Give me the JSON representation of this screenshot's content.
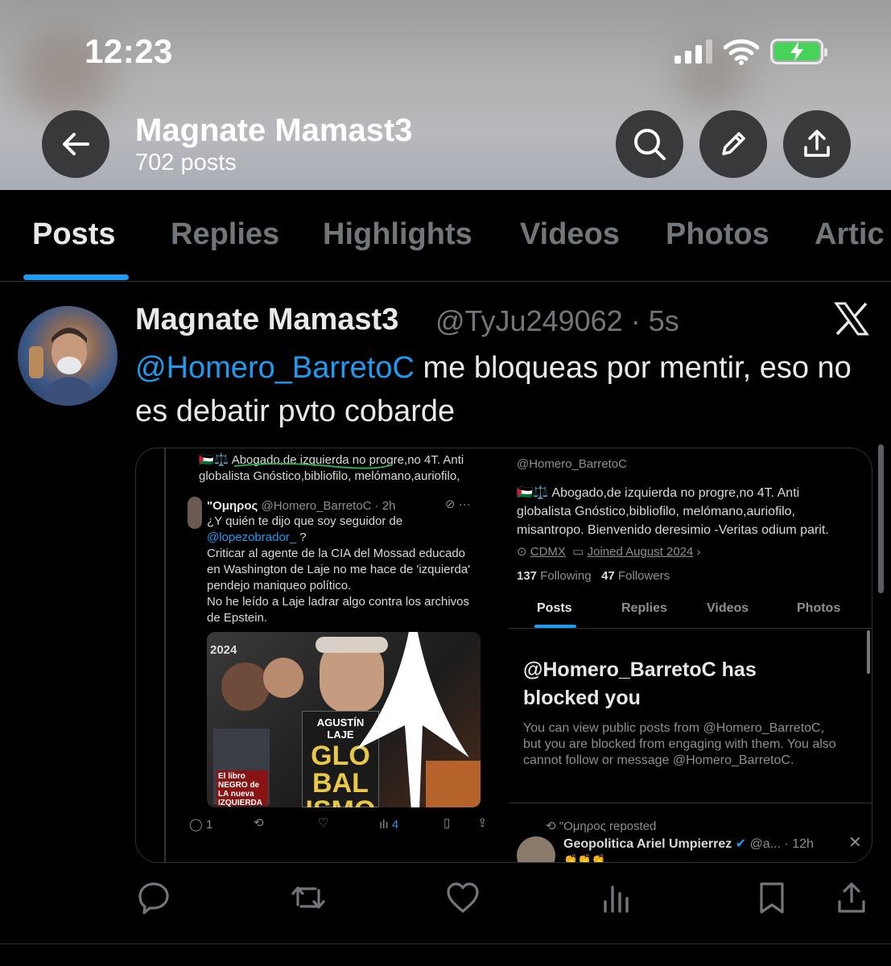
{
  "status_bar": {
    "time": "12:23"
  },
  "header": {
    "profile_name": "Magnate Mamast3",
    "post_count": "702 posts",
    "icons": [
      "back-arrow-icon",
      "search-icon",
      "pencil-icon",
      "share-icon"
    ]
  },
  "tabs": [
    {
      "label": "Posts",
      "active": true
    },
    {
      "label": "Replies",
      "active": false
    },
    {
      "label": "Highlights",
      "active": false
    },
    {
      "label": "Videos",
      "active": false
    },
    {
      "label": "Photos",
      "active": false
    },
    {
      "label": "Artic",
      "active": false
    }
  ],
  "tweet": {
    "name": "Magnate Mamast3",
    "handle_time": "@TyJu249062 · 5s",
    "mention": "@Homero_BarretoC",
    "text_rest": " me bloqueas por mentir, eso no es debatir pvto cobarde",
    "actions": [
      "reply-icon",
      "repost-icon",
      "like-icon",
      "views-icon",
      "bookmark-icon",
      "share-icon"
    ]
  },
  "embedded": {
    "left": {
      "bio_line1": "🇵🇸⚖️ Abogado,de izquierda no progre,no 4T. Anti",
      "bio_line2": "globalista Gnóstico,bibliofilo, melómano,auriofilo,",
      "author": "\"Ομηρος",
      "author_meta": "@Homero_BarretoC · 2h",
      "line1": "¿Y quién te dijo que soy seguidor de",
      "mention": "@lopezobrador_",
      "mention_after": " ?",
      "line3": "Criticar al agente de la CIA del Mossad educado",
      "line4": "en Washington de Laje no me hace de 'izquierda'",
      "line5": "pendejo maniqueo político.",
      "line6": "No he leído a Laje ladrar algo contra los archivos",
      "line7": "de Epstein.",
      "book_author": "AGUSTÍN LAJE",
      "book_title": "GLO BAL ISMO",
      "year": "2024",
      "red_book": "El libro NEGRO de LA nueva IZQUIERDA",
      "reply_count": "1",
      "view_count": "4"
    },
    "right": {
      "handle": "@Homero_BarretoC",
      "bio_line1": "🇵🇸⚖️ Abogado,de izquierda no progre,no 4T. Anti",
      "bio_line2": "globalista Gnóstico,bibliofilo, melómano,auriofilo,",
      "bio_line3": "misantropo. Bienvenido deresimio -Veritas odium parit.",
      "location": "CDMX",
      "joined": "Joined August 2024",
      "following_count": "137",
      "following_label": "Following",
      "followers_count": "47",
      "followers_label": "Followers",
      "tabs": [
        "Posts",
        "Replies",
        "Videos",
        "Photos"
      ],
      "blocked_title_1": "@Homero_BarretoC has",
      "blocked_title_2": "blocked you",
      "blocked_body_1": "You can view public posts from @Homero_BarretoC,",
      "blocked_body_2": "but you are blocked from engaging with them. You also",
      "blocked_body_3": "cannot follow or message @Homero_BarretoC.",
      "repost_label": "\"Ομηρος reposted",
      "repost_name": "Geopolitica Ariel Umpierrez",
      "repost_meta": "@a... · 12h",
      "emoji": "👏👏👏"
    }
  }
}
